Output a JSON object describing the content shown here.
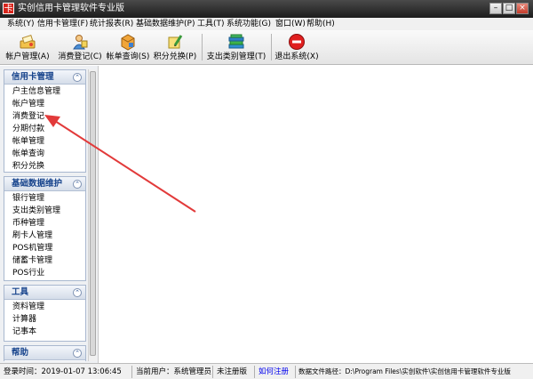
{
  "window": {
    "title": "实创信用卡管理软件专业版",
    "app_icon": "卡",
    "minimize": "–",
    "maximize": "□",
    "close": "×"
  },
  "menu": [
    "系统(Y)",
    "信用卡管理(F)",
    "统计报表(R)",
    "基础数据维护(P)",
    "工具(T)",
    "系统功能(G)",
    "窗口(W)",
    "帮助(H)"
  ],
  "toolbar": [
    {
      "label": "帐户管理(A)",
      "icon": "account-icon"
    },
    {
      "label": "消费登记(C)",
      "icon": "consume-register-icon"
    },
    {
      "label": "帐单查询(S)",
      "icon": "bill-query-icon"
    },
    {
      "label": "积分兑换(P)",
      "icon": "points-exchange-icon"
    },
    {
      "label": "支出类别管理(T)",
      "icon": "books-icon"
    },
    {
      "label": "退出系统(X)",
      "icon": "exit-icon"
    }
  ],
  "nav": {
    "collapse_glyph": "⌃",
    "groups": [
      {
        "title": "信用卡管理",
        "items": [
          "户主信息管理",
          "帐户管理",
          "消费登记",
          "分期付款",
          "帐单管理",
          "帐单查询",
          "积分兑换"
        ]
      },
      {
        "title": "基础数据维护",
        "items": [
          "银行管理",
          "支出类别管理",
          "币种管理",
          "刷卡人管理",
          "POS机管理",
          "储蓄卡管理",
          "POS行业"
        ]
      },
      {
        "title": "工具",
        "items": [
          "资料管理",
          "计算器",
          "记事本"
        ]
      },
      {
        "title": "帮助",
        "items": []
      }
    ]
  },
  "status": {
    "login_time": "登录时间：2019-01-07 13:06:45",
    "current_user": "当前用户：系统管理员",
    "register_state": "未注册版",
    "register_link": "如何注册",
    "data_path": "数据文件路径：D:\\Program Files\\实创软件\\实创信用卡管理软件专业版"
  },
  "colors": {
    "titlebar": "#2b2b2b",
    "nav_header": "#15428b",
    "arrow": "#e23a3a"
  }
}
